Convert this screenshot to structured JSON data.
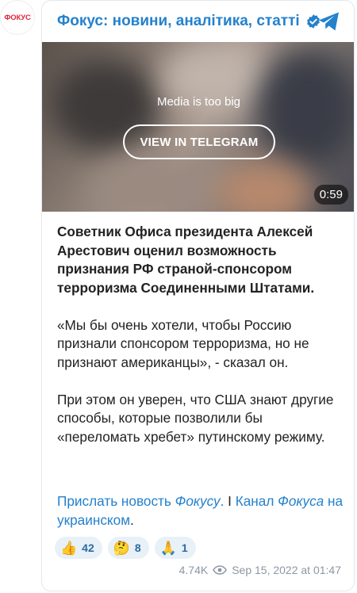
{
  "avatar": {
    "text": "ФОКУС"
  },
  "header": {
    "channel_title": "Фокус: новини, аналітика, статті"
  },
  "media": {
    "notice": "Media is too big",
    "button_label": "VIEW IN TELEGRAM",
    "duration": "0:59"
  },
  "post": {
    "paragraph1": "Советник Офиса президента Алексей Арестович оценил возможность признания РФ страной-спонсором терроризма Соединенными Штатами.",
    "paragraph2": "«Мы бы очень хотели, чтобы Россию признали спонсором терроризма, но не признают американцы», - сказал он.",
    "paragraph3": "При этом он уверен, что США знают другие способы, которые позволили бы «переломать хребет» путинскому режиму.",
    "link1_pre": "Прислать новость ",
    "link1_italic": "Фокусу",
    "link1_post": ".",
    "separator": " I ",
    "link2_pre": "Канал ",
    "link2_italic": "Фокуса",
    "link2_post": " на украинском",
    "link2_end": "."
  },
  "reactions": [
    {
      "emoji": "👍",
      "count": "42"
    },
    {
      "emoji": "🤔",
      "count": "8"
    },
    {
      "emoji": "🙏",
      "count": "1"
    }
  ],
  "meta": {
    "views": "4.74K",
    "date": "Sep 15, 2022 at 01:47"
  },
  "colors": {
    "accent": "#2481cc",
    "brand_red": "#e0253a"
  }
}
